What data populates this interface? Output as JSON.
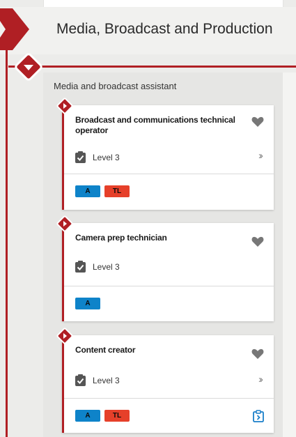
{
  "route": {
    "title": "Media, Broadcast and Production"
  },
  "group": {
    "label": "Media and broadcast assistant"
  },
  "cards": [
    {
      "title": "Broadcast and communications technical operator",
      "level": "Level 3",
      "badges": [
        "A",
        "TL"
      ],
      "has_more": true,
      "has_action": false
    },
    {
      "title": "Camera prep technician",
      "level": "Level 3",
      "badges": [
        "A"
      ],
      "has_more": false,
      "has_action": false
    },
    {
      "title": "Content creator",
      "level": "Level 3",
      "badges": [
        "A",
        "TL"
      ],
      "has_more": true,
      "has_action": true
    }
  ],
  "icons": {
    "favorite": "heart-icon",
    "level": "clipboard-check-icon",
    "more": "double-chevron-right-icon",
    "action": "clipboard-arrow-icon",
    "marker": "diamond-chevron-down-icon"
  },
  "colors": {
    "accent_red": "#b01f24",
    "badge_a": "#0e83c9",
    "badge_tl": "#e6402a",
    "action_blue": "#1a7fc9"
  }
}
